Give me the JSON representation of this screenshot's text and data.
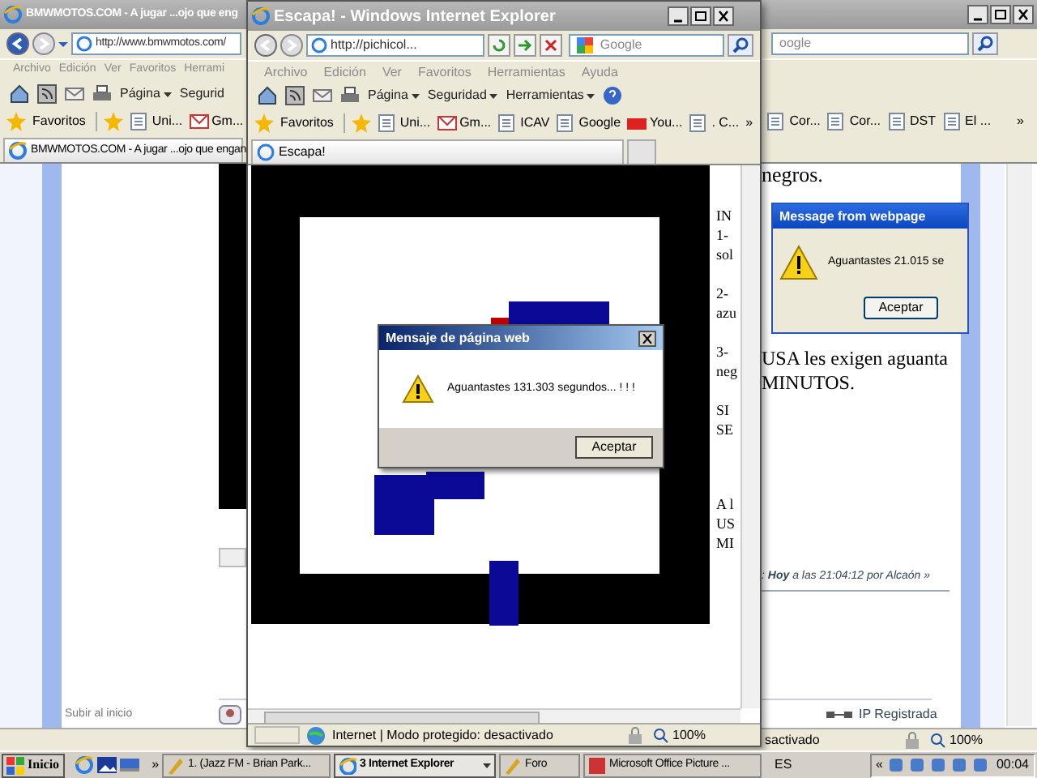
{
  "back_window": {
    "title": "BMWMOTOS.COM - A jugar ...ojo que eng",
    "address": "http://www.bmwmotos.com/",
    "search_text": "oogle",
    "menu": [
      "Archivo",
      "Edición",
      "Ver",
      "Favoritos",
      "Herrami"
    ],
    "command_bar": [
      "Página",
      "Segurid"
    ],
    "favorites_label": "Favoritos",
    "favorites": [
      "Uni...",
      "Gm..."
    ],
    "favorites_right": [
      "Cor...",
      "Cor...",
      "DST",
      "El ..."
    ],
    "more": "»",
    "tab": "BMWMOTOS.COM - A jugar ...ojo que engan",
    "page": {
      "heading_tail": "negros.",
      "lines": [
        "USA les exigen aguanta",
        "MINUTOS."
      ],
      "post_meta": ": **Hoy** a las 21:04:12 por Alcaón »",
      "ip": "IP Registrada",
      "back_to_top": "Subir al inicio"
    },
    "status": {
      "text": "sactivado",
      "zoom": "100%"
    }
  },
  "front_window": {
    "title": "Escapa! - Windows Internet Explorer",
    "address": "http://pichicol...",
    "search_text": "Google",
    "menu": [
      "Archivo",
      "Edición",
      "Ver",
      "Favoritos",
      "Herramientas",
      "Ayuda"
    ],
    "command_bar": [
      "Página",
      "Seguridad",
      "Herramientas"
    ],
    "favorites_label": "Favoritos",
    "favorites": [
      "Uni...",
      "Gm...",
      "ICAV",
      "Google",
      "You...",
      ". C..."
    ],
    "more": "»",
    "tab": "Escapa!",
    "side_text": [
      [
        "IN",
        "1-",
        "sol"
      ],
      [
        "2-",
        "azu"
      ],
      [
        "3-",
        "neg"
      ],
      [
        "SI",
        "SE"
      ],
      [
        "A l",
        "US",
        "MI"
      ]
    ],
    "status": {
      "text": "Internet | Modo protegido: desactivado",
      "zoom": "100%"
    }
  },
  "dialog": {
    "title": "Mensaje de página web",
    "message": "Aguantastes 131.303 segundos... ! ! !",
    "button": "Aceptar"
  },
  "back_dialog": {
    "title": "Message from webpage",
    "message": "Aguantastes 21.015 se",
    "button": "Aceptar"
  },
  "taskbar": {
    "start": "Inicio",
    "chevron": "»",
    "tasks": [
      {
        "label": "1.  (Jazz FM - Brian Park...",
        "selected": false
      },
      {
        "label": "3 Internet Explorer",
        "selected": true
      },
      {
        "label": "Foro",
        "selected": false
      },
      {
        "label": "Microsoft Office Picture ...",
        "selected": false
      }
    ],
    "language": "ES",
    "tray_chevron": "«",
    "clock": "00:04"
  }
}
